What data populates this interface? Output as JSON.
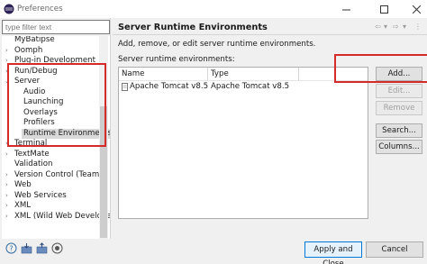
{
  "window": {
    "title": "Preferences"
  },
  "filter": {
    "placeholder": "type filter text"
  },
  "tree": {
    "items": [
      {
        "label": "MyBatipse",
        "has_arrow": false,
        "indent": 0
      },
      {
        "label": "Oomph",
        "has_arrow": true,
        "expanded": false,
        "indent": 0
      },
      {
        "label": "Plug-in Development",
        "has_arrow": true,
        "expanded": false,
        "indent": 0
      },
      {
        "label": "Run/Debug",
        "has_arrow": true,
        "expanded": false,
        "indent": 0
      },
      {
        "label": "Server",
        "has_arrow": true,
        "expanded": true,
        "indent": 0
      },
      {
        "label": "Audio",
        "has_arrow": false,
        "indent": 1
      },
      {
        "label": "Launching",
        "has_arrow": false,
        "indent": 1
      },
      {
        "label": "Overlays",
        "has_arrow": false,
        "indent": 1
      },
      {
        "label": "Profilers",
        "has_arrow": false,
        "indent": 1
      },
      {
        "label": "Runtime Environments",
        "has_arrow": false,
        "indent": 1,
        "selected": true
      },
      {
        "label": "Terminal",
        "has_arrow": true,
        "expanded": false,
        "indent": 0
      },
      {
        "label": "TextMate",
        "has_arrow": true,
        "expanded": false,
        "indent": 0
      },
      {
        "label": "Validation",
        "has_arrow": false,
        "indent": 0
      },
      {
        "label": "Version Control (Team)",
        "has_arrow": true,
        "expanded": false,
        "indent": 0
      },
      {
        "label": "Web",
        "has_arrow": true,
        "expanded": false,
        "indent": 0
      },
      {
        "label": "Web Services",
        "has_arrow": true,
        "expanded": false,
        "indent": 0
      },
      {
        "label": "XML",
        "has_arrow": true,
        "expanded": false,
        "indent": 0
      },
      {
        "label": "XML (Wild Web Developer)",
        "has_arrow": true,
        "expanded": false,
        "indent": 0
      }
    ]
  },
  "page": {
    "title": "Server Runtime Environments",
    "description": "Add, remove, or edit server runtime environments.",
    "list_label": "Server runtime environments:",
    "columns": [
      "Name",
      "Type"
    ],
    "rows": [
      {
        "name": "Apache Tomcat v8.5",
        "type": "Apache Tomcat v8.5"
      }
    ]
  },
  "buttons": {
    "add": "Add...",
    "edit": "Edit...",
    "remove": "Remove",
    "search": "Search...",
    "columns": "Columns..."
  },
  "footer": {
    "apply_close": "Apply and Close",
    "cancel": "Cancel"
  },
  "colors": {
    "highlight_box": "#d62a2a",
    "default_button_border": "#0078d7"
  }
}
